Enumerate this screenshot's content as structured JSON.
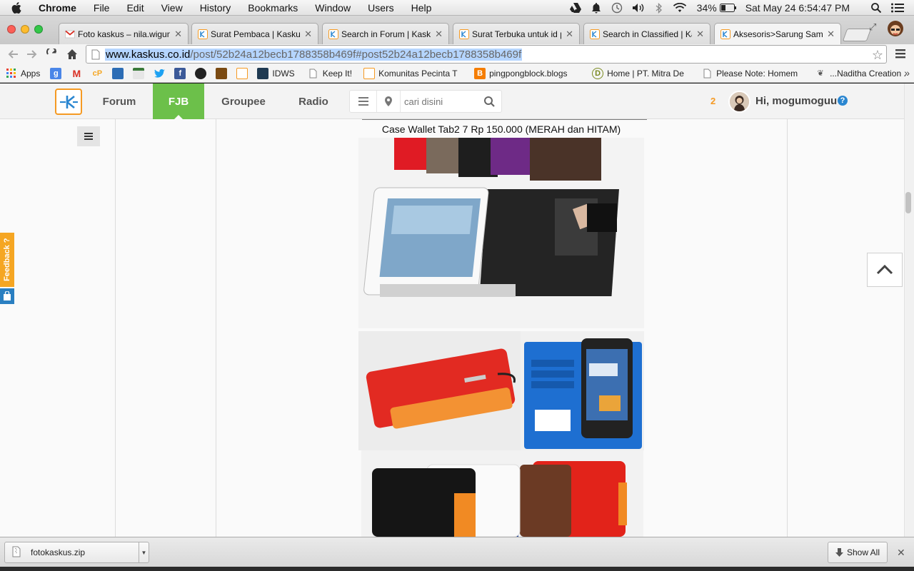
{
  "menubar": {
    "app": "Chrome",
    "items": [
      "File",
      "Edit",
      "View",
      "History",
      "Bookmarks",
      "Window",
      "Users",
      "Help"
    ],
    "battery": "34%",
    "clock": "Sat May 24   6:54:47 PM"
  },
  "tabs": [
    {
      "label": "Foto kaskus – nila.wigun",
      "icon": "gmail-icon"
    },
    {
      "label": "Surat Pembaca | Kaskus",
      "icon": "kaskus-icon"
    },
    {
      "label": "Search in Forum | Kaskus",
      "icon": "kaskus-icon"
    },
    {
      "label": "Surat Terbuka untuk id p",
      "icon": "kaskus-icon"
    },
    {
      "label": "Search in Classified | Ka",
      "icon": "kaskus-icon"
    },
    {
      "label": "Aksesoris>Sarung Samsu",
      "icon": "kaskus-icon"
    }
  ],
  "omnibox": {
    "host": "www.kaskus.co.id",
    "path": "/post/52b24a12becb1788358b469f#post52b24a12becb1788358b469f"
  },
  "bookmarks": [
    {
      "label": "Apps",
      "icon": "apps-grid-icon"
    },
    {
      "label": "",
      "icon": "google-icon"
    },
    {
      "label": "",
      "icon": "gmail-icon"
    },
    {
      "label": "",
      "icon": "cp-icon"
    },
    {
      "label": "",
      "icon": "bookmark-blue-icon"
    },
    {
      "label": "",
      "icon": "bookmark-news-icon"
    },
    {
      "label": "",
      "icon": "twitter-icon"
    },
    {
      "label": "",
      "icon": "facebook-icon"
    },
    {
      "label": "",
      "icon": "bookmark-dark-icon"
    },
    {
      "label": "",
      "icon": "bookmark-brown-icon"
    },
    {
      "label": "",
      "icon": "kaskus-icon"
    },
    {
      "label": "IDWS",
      "icon": "idws-icon"
    },
    {
      "label": "Keep It!",
      "icon": "page-icon"
    },
    {
      "label": "Komunitas Pecinta T",
      "icon": "kaskus-icon"
    },
    {
      "label": "pingpongblock.blogs",
      "icon": "blogger-icon"
    },
    {
      "label": "Home | PT. Mitra De",
      "icon": "mitra-icon"
    },
    {
      "label": "Please Note: Homem",
      "icon": "page-icon"
    },
    {
      "label": "...Naditha Creation .",
      "icon": "naditha-icon"
    }
  ],
  "kaskus": {
    "nav": [
      "Forum",
      "FJB",
      "Groupee",
      "Radio"
    ],
    "search_placeholder": "cari disini",
    "notif_count": "2",
    "greeting": "Hi, mogumoguu",
    "help": "?"
  },
  "post": {
    "caption": "Case Wallet Tab2 7 Rp 150.000 (MERAH dan HITAM)",
    "images": [
      {
        "name": "case-wallet-photo-1",
        "description": "tablet in black wallet case with colored cases behind"
      },
      {
        "name": "case-wallet-photo-2a",
        "description": "red and orange wallet case"
      },
      {
        "name": "case-wallet-photo-2b",
        "description": "blue wallet case with tablet"
      },
      {
        "name": "case-wallet-photo-3",
        "description": "black, white, brown and red wallet cases"
      }
    ]
  },
  "feedback": {
    "label": "Feedback ?"
  },
  "downloads": {
    "file": "fotokaskus.zip",
    "show_all": "Show All"
  },
  "colors": {
    "fjb_green": "#6cc04a",
    "kaskus_orange": "#f59a23",
    "selection_blue": "#b5d5ff"
  }
}
